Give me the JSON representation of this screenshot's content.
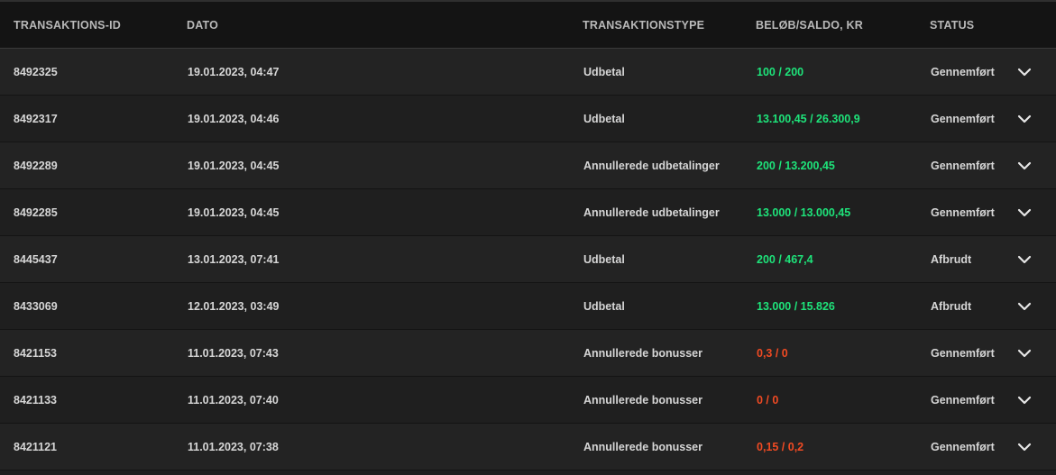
{
  "colors": {
    "background": "#1e1e1e",
    "header_background": "#141414",
    "positive_amount": "#1ee37a",
    "negative_amount": "#f04a23",
    "text": "#d6d6d6"
  },
  "table": {
    "headers": {
      "id": "TRANSAKTIONS-ID",
      "date": "DATO",
      "type": "TRANSAKTIONSTYPE",
      "amount": "BELØB/SALDO, KR",
      "status": "STATUS"
    },
    "rows": [
      {
        "id": "8492325",
        "date": "19.01.2023, 04:47",
        "type": "Udbetal",
        "amount": "100 / 200",
        "amount_sign": "pos",
        "status": "Gennemført"
      },
      {
        "id": "8492317",
        "date": "19.01.2023, 04:46",
        "type": "Udbetal",
        "amount": "13.100,45 / 26.300,9",
        "amount_sign": "pos",
        "status": "Gennemført"
      },
      {
        "id": "8492289",
        "date": "19.01.2023, 04:45",
        "type": "Annullerede udbetalinger",
        "amount": "200 / 13.200,45",
        "amount_sign": "pos",
        "status": "Gennemført"
      },
      {
        "id": "8492285",
        "date": "19.01.2023, 04:45",
        "type": "Annullerede udbetalinger",
        "amount": "13.000 / 13.000,45",
        "amount_sign": "pos",
        "status": "Gennemført"
      },
      {
        "id": "8445437",
        "date": "13.01.2023, 07:41",
        "type": "Udbetal",
        "amount": "200 / 467,4",
        "amount_sign": "pos",
        "status": "Afbrudt"
      },
      {
        "id": "8433069",
        "date": "12.01.2023, 03:49",
        "type": "Udbetal",
        "amount": "13.000 / 15.826",
        "amount_sign": "pos",
        "status": "Afbrudt"
      },
      {
        "id": "8421153",
        "date": "11.01.2023, 07:43",
        "type": "Annullerede bonusser",
        "amount": "0,3 / 0",
        "amount_sign": "neg",
        "status": "Gennemført"
      },
      {
        "id": "8421133",
        "date": "11.01.2023, 07:40",
        "type": "Annullerede bonusser",
        "amount": "0 / 0",
        "amount_sign": "neg",
        "status": "Gennemført"
      },
      {
        "id": "8421121",
        "date": "11.01.2023, 07:38",
        "type": "Annullerede bonusser",
        "amount": "0,15 / 0,2",
        "amount_sign": "neg",
        "status": "Gennemført"
      }
    ],
    "row_action_icon": "chevron-down-icon"
  }
}
